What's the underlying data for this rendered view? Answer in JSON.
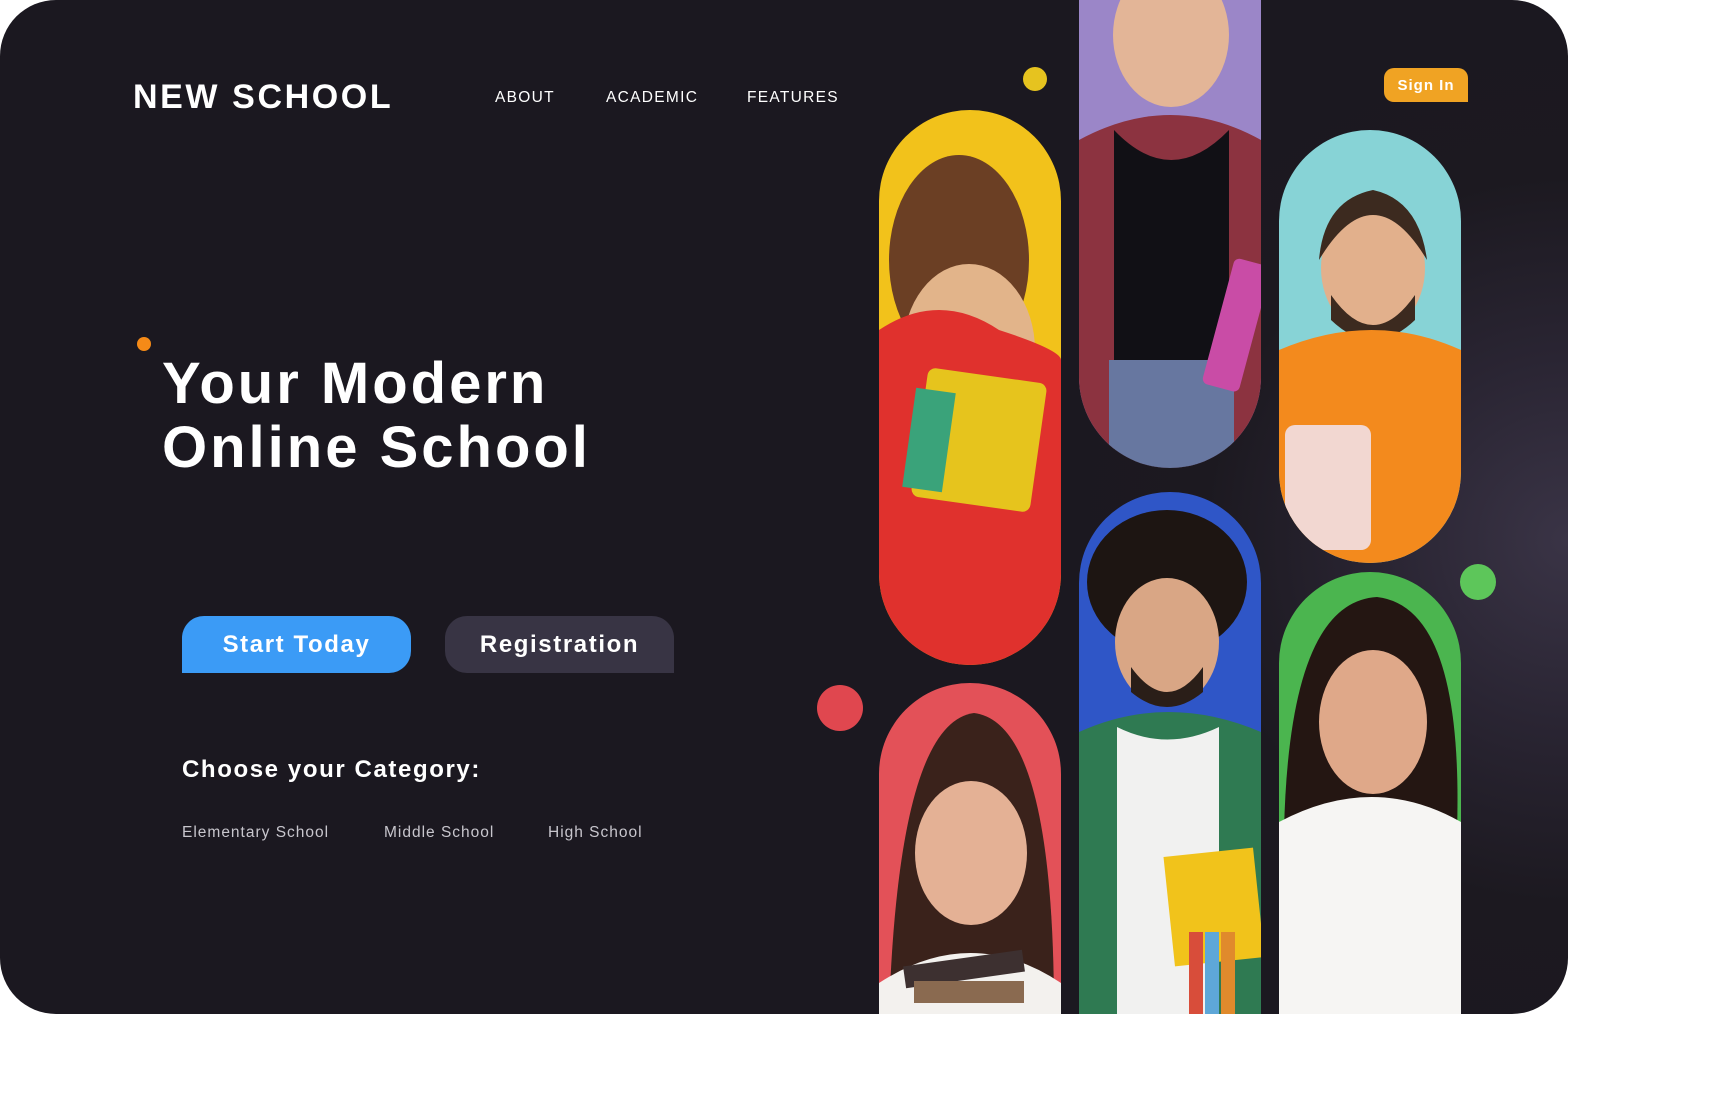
{
  "brand": {
    "logo": "NEW SCHOOL"
  },
  "nav": {
    "items": [
      "ABOUT",
      "ACADEMIC",
      "FEATURES"
    ]
  },
  "header": {
    "sign_in": "Sign In"
  },
  "hero": {
    "headline_line1": "Your Modern",
    "headline_line2": "Online School",
    "primary_cta": "Start Today",
    "secondary_cta": "Registration"
  },
  "categories": {
    "title": "Choose your Category:",
    "items": [
      "Elementary School",
      "Middle School",
      "High School"
    ]
  },
  "gallery": {
    "photos": [
      {
        "icon": "student-photo-curly-hair-red-hoodie",
        "background": "#f2c21b"
      },
      {
        "icon": "student-photo-plaid-shirt",
        "background": "#9b86c8"
      },
      {
        "icon": "student-photo-orange-sweater",
        "background": "#87d3d6"
      },
      {
        "icon": "student-photo-dark-hair-books",
        "background": "#e35158"
      },
      {
        "icon": "student-photo-green-plaid-shirt",
        "background": "#2f56c7"
      },
      {
        "icon": "student-photo-white-blouse",
        "background": "#4bb54f"
      }
    ]
  },
  "colors": {
    "background": "#1b1820",
    "accent_blue": "#3b9bf6",
    "accent_orange": "#f0a323",
    "dot_yellow": "#e6c31f",
    "dot_red": "#e0474f",
    "dot_green": "#5dc65a",
    "dot_orange": "#f58a17"
  }
}
